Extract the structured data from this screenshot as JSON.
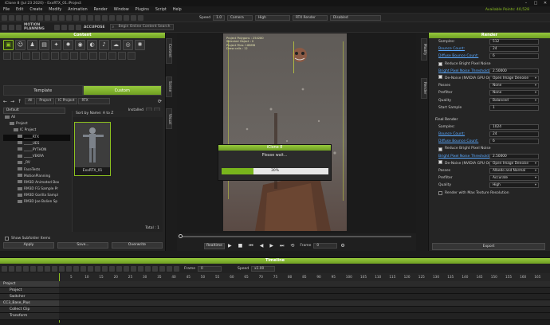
{
  "window": {
    "title": "iClone 8 (Jul 23 2020) - ExxRTX_01.iProject",
    "points_label": "Available Points: 40,528"
  },
  "menu": [
    "File",
    "Edit",
    "Create",
    "Modify",
    "Animation",
    "Render",
    "Window",
    "Plugins",
    "Script",
    "Help"
  ],
  "toolbar": {
    "speed_label": "Speed",
    "speed_value": "1.0",
    "camera_label": "Camera",
    "quality_value": "High",
    "render_value": "RTX Render",
    "state_value": "Disabled"
  },
  "toolbar2": {
    "brand_motion": "MOTION PLANNING",
    "brand_accu": "ACCUPOSE",
    "search_placeholder": "Begin Online Content Search"
  },
  "content": {
    "header": "Content",
    "tabs": [
      {
        "label": "Template"
      },
      {
        "label": "Custom"
      }
    ],
    "path": [
      "All",
      "Project",
      "IC Project",
      "RTX"
    ],
    "filter_value": "Default",
    "installed_label": "Installed",
    "sort_label": "Sort by Name: A to Z",
    "tree": [
      {
        "label": "All"
      },
      {
        "label": "Project"
      },
      {
        "label": "IC Project"
      },
      {
        "label": "_____RTX"
      },
      {
        "label": "_____UES"
      },
      {
        "label": "_____PYTHON"
      },
      {
        "label": "_____VEKRA"
      },
      {
        "label": "_RV"
      },
      {
        "label": "FaceTests"
      },
      {
        "label": "MotionPlanning"
      },
      {
        "label": "RM3D Animated Box"
      },
      {
        "label": "RM3D FG Sample Pr"
      },
      {
        "label": "RM3D Gorilla Sampl"
      },
      {
        "label": "RM3D Joe Bolien Sp"
      }
    ],
    "thumb_label": "ExxRTX_01",
    "total_label": "Total : 1",
    "show_subfolder": "Show Subfolder Items",
    "filter_base": "Filter by Base Type",
    "buttons": {
      "apply": "Apply",
      "save": "Save...",
      "overwrite": "Overwrite"
    }
  },
  "sidetabs": {
    "content": "Content",
    "scene": "Scene",
    "visual": "Visual",
    "modify": "Modify",
    "render": "Render"
  },
  "viewport": {
    "stats": [
      "Project Polygons : 254280",
      "Selected Object : 0",
      "Project Files: 168MB",
      "Draw calls : 12"
    ],
    "dialog_title": "iClone 8",
    "dialog_msg": "Please wait...",
    "progress": 30,
    "progress_text": "30%"
  },
  "playback": {
    "mode": "Realtime",
    "frame_label": "Frame",
    "frame_value": "0"
  },
  "render": {
    "header": "Render",
    "preview": [
      {
        "label": "Samples:",
        "value": "512",
        "link": false
      },
      {
        "label": "Bounce Count:",
        "value": "24",
        "link": true
      },
      {
        "label": "Diffuse Bounce Count:",
        "value": "6",
        "link": true
      }
    ],
    "reduce_noise_1": "Reduce Bright Pixel Noise",
    "threshold_1": {
      "label": "Bright Pixel Noise Threshold:",
      "value": "2.50000"
    },
    "denoise_1": {
      "label": "De-Noise (NVIDIA GPU Only)",
      "value": "Open Image Denoise"
    },
    "opts1": [
      {
        "label": "Passes",
        "value": "None"
      },
      {
        "label": "Prefilter",
        "value": "None"
      },
      {
        "label": "Quality",
        "value": "Balanced"
      },
      {
        "label": "Start Sample",
        "value": "1"
      }
    ],
    "final_title": "Final Render",
    "final": [
      {
        "label": "Samples:",
        "value": "1024",
        "link": false
      },
      {
        "label": "Bounce Count:",
        "value": "24",
        "link": true
      },
      {
        "label": "Diffuse Bounce Count:",
        "value": "6",
        "link": true
      }
    ],
    "reduce_noise_2": "Reduce Bright Pixel Noise",
    "threshold_2": {
      "label": "Bright Pixel Noise Threshold:",
      "value": "2.50000"
    },
    "denoise_2": {
      "label": "De-Noise (NVIDIA GPU Only)",
      "value": "Open Image Denoise"
    },
    "opts2": [
      {
        "label": "Passes",
        "value": "Albedo and Normal"
      },
      {
        "label": "Prefilter",
        "value": "Accurate"
      },
      {
        "label": "Quality",
        "value": "High"
      }
    ],
    "max_texture": "Render with Max Texture Resolution",
    "export": "Export"
  },
  "timeline": {
    "header": "Timeline",
    "frame_label": "Frame",
    "frame_value": "0",
    "speed_label": "Speed",
    "speed_value": "x1.00",
    "ticks": [
      "5",
      "10",
      "15",
      "20",
      "25",
      "30",
      "35",
      "40",
      "45",
      "50",
      "55",
      "60",
      "65",
      "70",
      "75",
      "80",
      "85",
      "90",
      "95",
      "100",
      "105",
      "110",
      "115",
      "120",
      "125",
      "130",
      "135",
      "140",
      "145",
      "150",
      "155",
      "160",
      "165"
    ],
    "tracks": [
      "Project",
      "Project",
      "Switcher",
      "CC3_Base_Plus",
      "Collect Clip",
      "Transform"
    ]
  }
}
